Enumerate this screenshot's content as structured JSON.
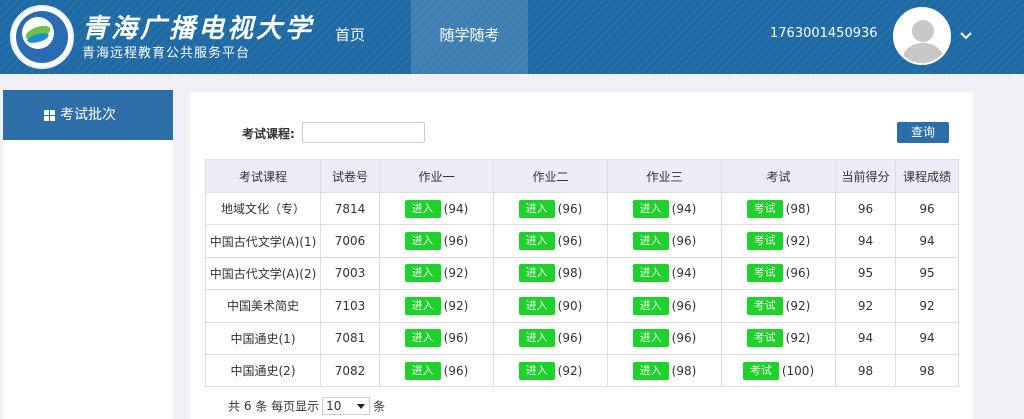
{
  "header": {
    "brand_title": "青海广播电视大学",
    "brand_subtitle": "青海远程教育公共服务平台",
    "nav": [
      {
        "label": "首页"
      },
      {
        "label": "随学随考"
      }
    ],
    "user_id": "1763001450936"
  },
  "sidebar": {
    "items": [
      {
        "label": "考试批次",
        "icon": "grid-icon"
      }
    ]
  },
  "search": {
    "label": "考试课程:",
    "value": "",
    "button_label": "查询"
  },
  "table": {
    "columns": [
      "考试课程",
      "试卷号",
      "作业一",
      "作业二",
      "作业三",
      "考试",
      "当前得分",
      "课程成绩"
    ],
    "rows": [
      {
        "course": "地域文化（专）",
        "paper": "7814",
        "hw1_btn": "进入",
        "hw1": "(94)",
        "hw2_btn": "进入",
        "hw2": "(96)",
        "hw3_btn": "进入",
        "hw3": "(94)",
        "exam_btn": "考试",
        "exam": "(98)",
        "current": "96",
        "final": "96"
      },
      {
        "course": "中国古代文学(A)(1)",
        "paper": "7006",
        "hw1_btn": "进入",
        "hw1": "(96)",
        "hw2_btn": "进入",
        "hw2": "(96)",
        "hw3_btn": "进入",
        "hw3": "(96)",
        "exam_btn": "考试",
        "exam": "(92)",
        "current": "94",
        "final": "94"
      },
      {
        "course": "中国古代文学(A)(2)",
        "paper": "7003",
        "hw1_btn": "进入",
        "hw1": "(92)",
        "hw2_btn": "进入",
        "hw2": "(98)",
        "hw3_btn": "进入",
        "hw3": "(94)",
        "exam_btn": "考试",
        "exam": "(96)",
        "current": "95",
        "final": "95"
      },
      {
        "course": "中国美术简史",
        "paper": "7103",
        "hw1_btn": "进入",
        "hw1": "(92)",
        "hw2_btn": "进入",
        "hw2": "(90)",
        "hw3_btn": "进入",
        "hw3": "(96)",
        "exam_btn": "考试",
        "exam": "(92)",
        "current": "92",
        "final": "92"
      },
      {
        "course": "中国通史(1)",
        "paper": "7081",
        "hw1_btn": "进入",
        "hw1": "(96)",
        "hw2_btn": "进入",
        "hw2": "(96)",
        "hw3_btn": "进入",
        "hw3": "(96)",
        "exam_btn": "考试",
        "exam": "(92)",
        "current": "94",
        "final": "94"
      },
      {
        "course": "中国通史(2)",
        "paper": "7082",
        "hw1_btn": "进入",
        "hw1": "(96)",
        "hw2_btn": "进入",
        "hw2": "(92)",
        "hw3_btn": "进入",
        "hw3": "(98)",
        "exam_btn": "考试",
        "exam": "(100)",
        "current": "98",
        "final": "98"
      }
    ]
  },
  "footer": {
    "prefix": "共",
    "total": "6",
    "unit_mid": "条 每页显示",
    "page_size": "10",
    "suffix": "条"
  },
  "colors": {
    "header_bg": "#1f6aa5",
    "accent": "#2d6ea8",
    "action_green": "#1dd32b",
    "table_header_bg": "#ecedf7"
  }
}
